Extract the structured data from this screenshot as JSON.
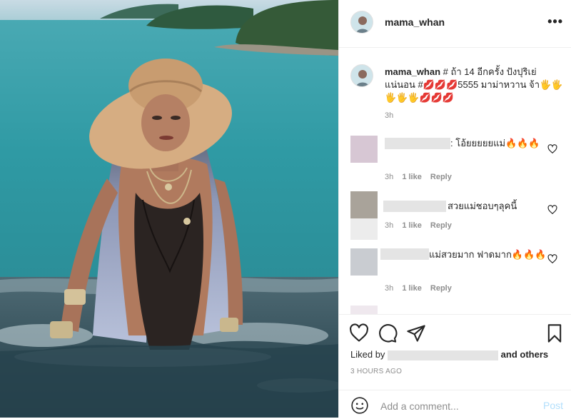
{
  "post": {
    "username": "mama_whan"
  },
  "caption": {
    "username": "mama_whan",
    "text": "# ถ้า 14 อีกครั้ง ปังปุริเย่ แน่นอน #💋💋💋5555 มาม่าหวาน จ้า🖐🖐🖐🖐🖐💋💋💋",
    "time": "3h"
  },
  "comments": [
    {
      "text": ": โอ้ยยยยยแม่🔥🔥🔥",
      "time": "3h",
      "likes": "1 like",
      "reply": "Reply"
    },
    {
      "text": "สวยแม่ชอบๆลุคนี้",
      "time": "3h",
      "likes": "1 like",
      "reply": "Reply"
    },
    {
      "text": "แม่สวยมาก ฟาดมาก🔥🔥🔥",
      "time": "3h",
      "likes": "1 like",
      "reply": "Reply"
    }
  ],
  "likes": {
    "prefix": "Liked by",
    "suffix": "and others"
  },
  "timestamp": "3 HOURS AGO",
  "add_comment": {
    "placeholder": "Add a comment...",
    "post_label": "Post"
  },
  "colors": {
    "post_button": "#b2dffc",
    "sea": "#2f8f9c",
    "hat": "#d6ad82"
  },
  "icons": [
    "more-options-icon",
    "heart-icon",
    "comment-icon",
    "share-icon",
    "bookmark-icon",
    "emoji-icon"
  ]
}
